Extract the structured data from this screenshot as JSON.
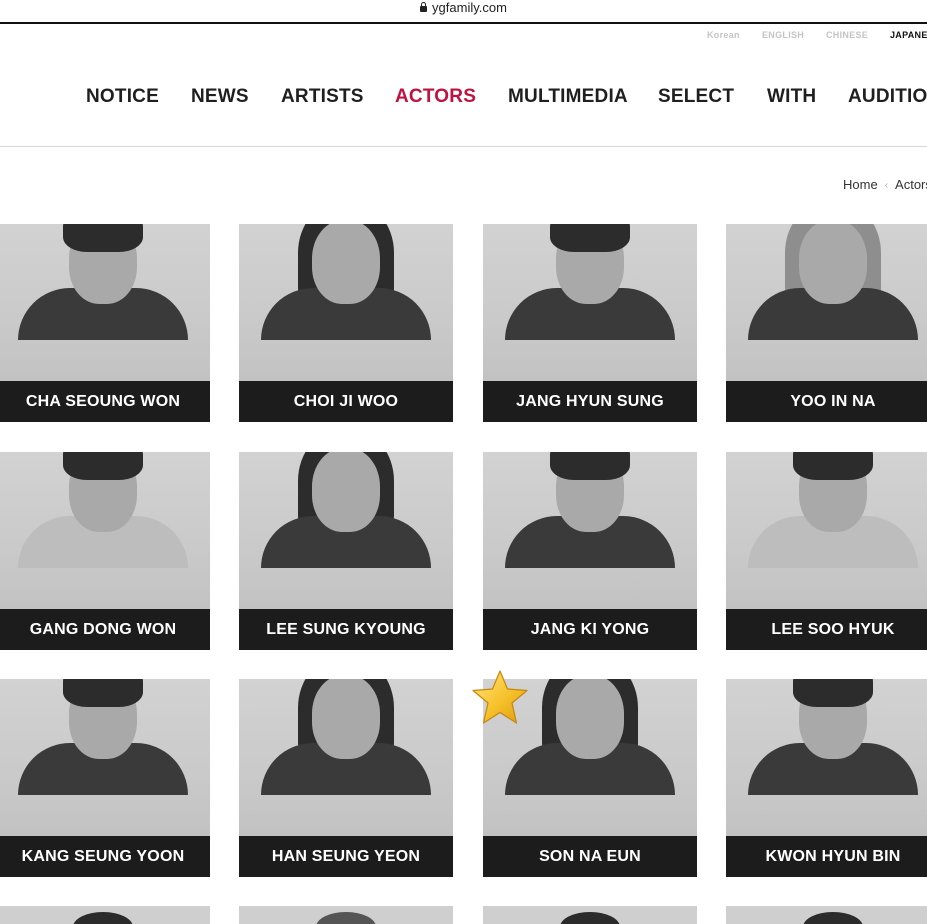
{
  "browser": {
    "url": "ygfamily.com"
  },
  "languages": [
    "Korean",
    "ENGLISH",
    "CHINESE",
    "JAPANESE"
  ],
  "active_language": "JAPANESE",
  "nav": [
    "NOTICE",
    "NEWS",
    "ARTISTS",
    "ACTORS",
    "MULTIMEDIA",
    "SELECT",
    "WITH",
    "AUDITION"
  ],
  "active_nav": "ACTORS",
  "breadcrumb": {
    "home": "Home",
    "current": "Actors"
  },
  "actors": [
    "CHA SEOUNG WON",
    "CHOI JI WOO",
    "JANG HYUN SUNG",
    "YOO IN NA",
    "GANG DONG WON",
    "LEE SUNG KYOUNG",
    "JANG KI YONG",
    "LEE SOO HYUK",
    "KANG SEUNG YOON",
    "HAN SEUNG YEON",
    "SON NA EUN",
    "KWON HYUN BIN"
  ],
  "colors": {
    "accent": "#c0113f",
    "caption_bg": "#1c1c1c",
    "card_bg": "#cfcfcf"
  },
  "icons": {
    "favorite": "star-icon",
    "secure": "lock-icon"
  }
}
